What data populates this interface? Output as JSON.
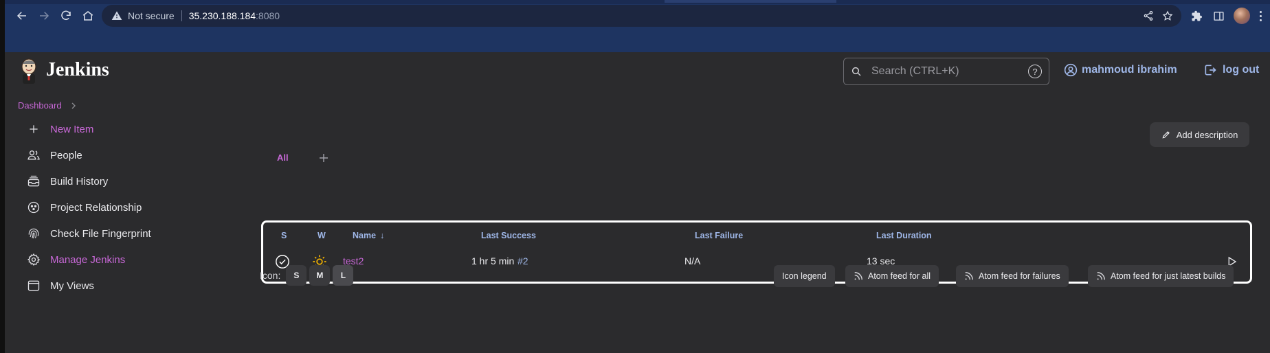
{
  "browser": {
    "address": {
      "security_label": "Not secure",
      "host": "35.230.188.184",
      "port": ":8080"
    }
  },
  "header": {
    "brand": "Jenkins",
    "search_placeholder": "Search (CTRL+K)",
    "help_glyph": "?",
    "user_name": "mahmoud ibrahim",
    "logout_label": "log out"
  },
  "breadcrumb": {
    "items": [
      "Dashboard"
    ]
  },
  "sidebar": {
    "items": [
      {
        "label": "New Item",
        "icon": "plus-icon",
        "accent": true
      },
      {
        "label": "People",
        "icon": "people-icon",
        "accent": false
      },
      {
        "label": "Build History",
        "icon": "build-history-icon",
        "accent": false
      },
      {
        "label": "Project Relationship",
        "icon": "relationship-icon",
        "accent": false
      },
      {
        "label": "Check File Fingerprint",
        "icon": "fingerprint-icon",
        "accent": false
      },
      {
        "label": "Manage Jenkins",
        "icon": "gear-icon",
        "accent": true
      },
      {
        "label": "My Views",
        "icon": "window-icon",
        "accent": false
      }
    ]
  },
  "main": {
    "add_description_label": "Add description",
    "view_tabs": [
      "All"
    ],
    "table": {
      "headers": {
        "status": "S",
        "weather": "W",
        "name": "Name",
        "name_sort": "↓",
        "last_success": "Last Success",
        "last_failure": "Last Failure",
        "last_duration": "Last Duration"
      },
      "rows": [
        {
          "status_icon": "check-circle-icon",
          "weather_icon": "sun-icon",
          "name": "test2",
          "last_success_time": "1 hr 5 min",
          "last_success_build": "#2",
          "last_failure": "N/A",
          "last_duration": "13 sec"
        }
      ]
    },
    "icon_size": {
      "label": "Icon:",
      "options": [
        "S",
        "M",
        "L"
      ],
      "selected": "L"
    },
    "footer_buttons": {
      "legend": "Icon legend",
      "feed_all": "Atom feed for all",
      "feed_failures": "Atom feed for failures",
      "feed_latest": "Atom feed for just latest builds"
    }
  },
  "colors": {
    "accent": "#c768d6",
    "link_blue": "#9fb7e8",
    "page_bg": "#2b2b2d",
    "chrome_bg": "#1e3461",
    "success": "#ffffff",
    "weather_sun": "#f4b400"
  }
}
